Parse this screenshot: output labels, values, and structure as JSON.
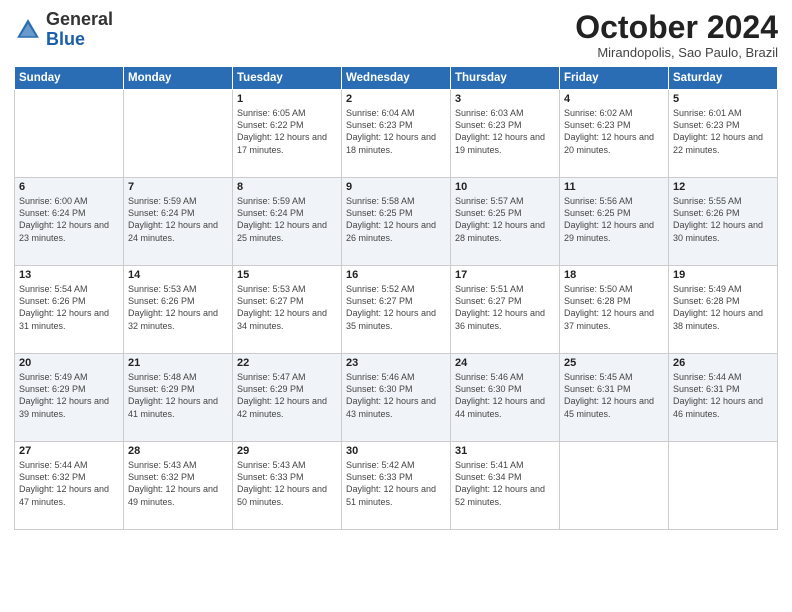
{
  "header": {
    "logo_general": "General",
    "logo_blue": "Blue",
    "month_title": "October 2024",
    "subtitle": "Mirandopolis, Sao Paulo, Brazil"
  },
  "weekdays": [
    "Sunday",
    "Monday",
    "Tuesday",
    "Wednesday",
    "Thursday",
    "Friday",
    "Saturday"
  ],
  "weeks": [
    [
      {
        "day": "",
        "info": ""
      },
      {
        "day": "",
        "info": ""
      },
      {
        "day": "1",
        "info": "Sunrise: 6:05 AM\nSunset: 6:22 PM\nDaylight: 12 hours and 17 minutes."
      },
      {
        "day": "2",
        "info": "Sunrise: 6:04 AM\nSunset: 6:23 PM\nDaylight: 12 hours and 18 minutes."
      },
      {
        "day": "3",
        "info": "Sunrise: 6:03 AM\nSunset: 6:23 PM\nDaylight: 12 hours and 19 minutes."
      },
      {
        "day": "4",
        "info": "Sunrise: 6:02 AM\nSunset: 6:23 PM\nDaylight: 12 hours and 20 minutes."
      },
      {
        "day": "5",
        "info": "Sunrise: 6:01 AM\nSunset: 6:23 PM\nDaylight: 12 hours and 22 minutes."
      }
    ],
    [
      {
        "day": "6",
        "info": "Sunrise: 6:00 AM\nSunset: 6:24 PM\nDaylight: 12 hours and 23 minutes."
      },
      {
        "day": "7",
        "info": "Sunrise: 5:59 AM\nSunset: 6:24 PM\nDaylight: 12 hours and 24 minutes."
      },
      {
        "day": "8",
        "info": "Sunrise: 5:59 AM\nSunset: 6:24 PM\nDaylight: 12 hours and 25 minutes."
      },
      {
        "day": "9",
        "info": "Sunrise: 5:58 AM\nSunset: 6:25 PM\nDaylight: 12 hours and 26 minutes."
      },
      {
        "day": "10",
        "info": "Sunrise: 5:57 AM\nSunset: 6:25 PM\nDaylight: 12 hours and 28 minutes."
      },
      {
        "day": "11",
        "info": "Sunrise: 5:56 AM\nSunset: 6:25 PM\nDaylight: 12 hours and 29 minutes."
      },
      {
        "day": "12",
        "info": "Sunrise: 5:55 AM\nSunset: 6:26 PM\nDaylight: 12 hours and 30 minutes."
      }
    ],
    [
      {
        "day": "13",
        "info": "Sunrise: 5:54 AM\nSunset: 6:26 PM\nDaylight: 12 hours and 31 minutes."
      },
      {
        "day": "14",
        "info": "Sunrise: 5:53 AM\nSunset: 6:26 PM\nDaylight: 12 hours and 32 minutes."
      },
      {
        "day": "15",
        "info": "Sunrise: 5:53 AM\nSunset: 6:27 PM\nDaylight: 12 hours and 34 minutes."
      },
      {
        "day": "16",
        "info": "Sunrise: 5:52 AM\nSunset: 6:27 PM\nDaylight: 12 hours and 35 minutes."
      },
      {
        "day": "17",
        "info": "Sunrise: 5:51 AM\nSunset: 6:27 PM\nDaylight: 12 hours and 36 minutes."
      },
      {
        "day": "18",
        "info": "Sunrise: 5:50 AM\nSunset: 6:28 PM\nDaylight: 12 hours and 37 minutes."
      },
      {
        "day": "19",
        "info": "Sunrise: 5:49 AM\nSunset: 6:28 PM\nDaylight: 12 hours and 38 minutes."
      }
    ],
    [
      {
        "day": "20",
        "info": "Sunrise: 5:49 AM\nSunset: 6:29 PM\nDaylight: 12 hours and 39 minutes."
      },
      {
        "day": "21",
        "info": "Sunrise: 5:48 AM\nSunset: 6:29 PM\nDaylight: 12 hours and 41 minutes."
      },
      {
        "day": "22",
        "info": "Sunrise: 5:47 AM\nSunset: 6:29 PM\nDaylight: 12 hours and 42 minutes."
      },
      {
        "day": "23",
        "info": "Sunrise: 5:46 AM\nSunset: 6:30 PM\nDaylight: 12 hours and 43 minutes."
      },
      {
        "day": "24",
        "info": "Sunrise: 5:46 AM\nSunset: 6:30 PM\nDaylight: 12 hours and 44 minutes."
      },
      {
        "day": "25",
        "info": "Sunrise: 5:45 AM\nSunset: 6:31 PM\nDaylight: 12 hours and 45 minutes."
      },
      {
        "day": "26",
        "info": "Sunrise: 5:44 AM\nSunset: 6:31 PM\nDaylight: 12 hours and 46 minutes."
      }
    ],
    [
      {
        "day": "27",
        "info": "Sunrise: 5:44 AM\nSunset: 6:32 PM\nDaylight: 12 hours and 47 minutes."
      },
      {
        "day": "28",
        "info": "Sunrise: 5:43 AM\nSunset: 6:32 PM\nDaylight: 12 hours and 49 minutes."
      },
      {
        "day": "29",
        "info": "Sunrise: 5:43 AM\nSunset: 6:33 PM\nDaylight: 12 hours and 50 minutes."
      },
      {
        "day": "30",
        "info": "Sunrise: 5:42 AM\nSunset: 6:33 PM\nDaylight: 12 hours and 51 minutes."
      },
      {
        "day": "31",
        "info": "Sunrise: 5:41 AM\nSunset: 6:34 PM\nDaylight: 12 hours and 52 minutes."
      },
      {
        "day": "",
        "info": ""
      },
      {
        "day": "",
        "info": ""
      }
    ]
  ]
}
